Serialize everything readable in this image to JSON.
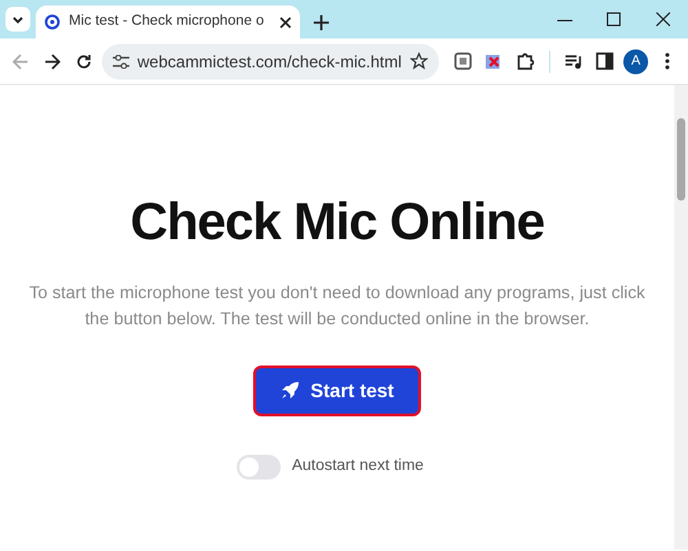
{
  "tab": {
    "title": "Mic test - Check microphone o",
    "selected": true
  },
  "address": "webcammictest.com/check-mic.html",
  "profile": "A",
  "page": {
    "heading": "Check Mic Online",
    "text": "To start the microphone test you don't need to download any programs, just click the button below. The test will be conducted online in the browser.",
    "button": "Start test",
    "toggle": {
      "label": "Autostart next time",
      "on": false
    }
  }
}
